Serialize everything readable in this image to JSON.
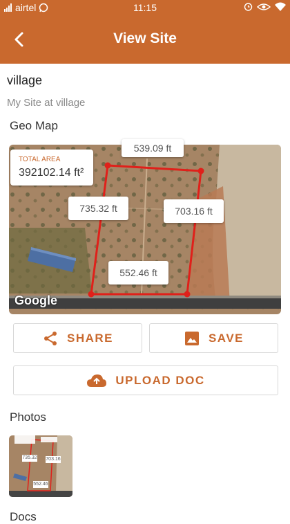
{
  "status_bar": {
    "carrier": "airtel",
    "time": "11:15",
    "icons": [
      "signal-icon",
      "whatsapp-icon",
      "alarm-icon",
      "eye-icon",
      "wifi-icon"
    ]
  },
  "header": {
    "title": "View Site",
    "back_icon": "chevron-left-icon"
  },
  "site": {
    "name": "village",
    "subtitle": "My Site at village"
  },
  "geo_map": {
    "heading": "Geo Map",
    "total_area_label": "TOTAL AREA",
    "total_area_value": "392102.14 ft²",
    "side_lengths": {
      "top": "539.09 ft",
      "left": "735.32 ft",
      "right": "703.16 ft",
      "bottom": "552.46 ft"
    },
    "attribution": "Google"
  },
  "actions": {
    "share_label": "SHARE",
    "save_label": "SAVE",
    "upload_label": "UPLOAD DOC"
  },
  "photos": {
    "heading": "Photos",
    "thumb_labels": [
      "735.32",
      "703.16",
      "552.46"
    ]
  },
  "docs": {
    "heading": "Docs"
  },
  "colors": {
    "accent": "#c9692e",
    "boundary": "#e0201a"
  }
}
